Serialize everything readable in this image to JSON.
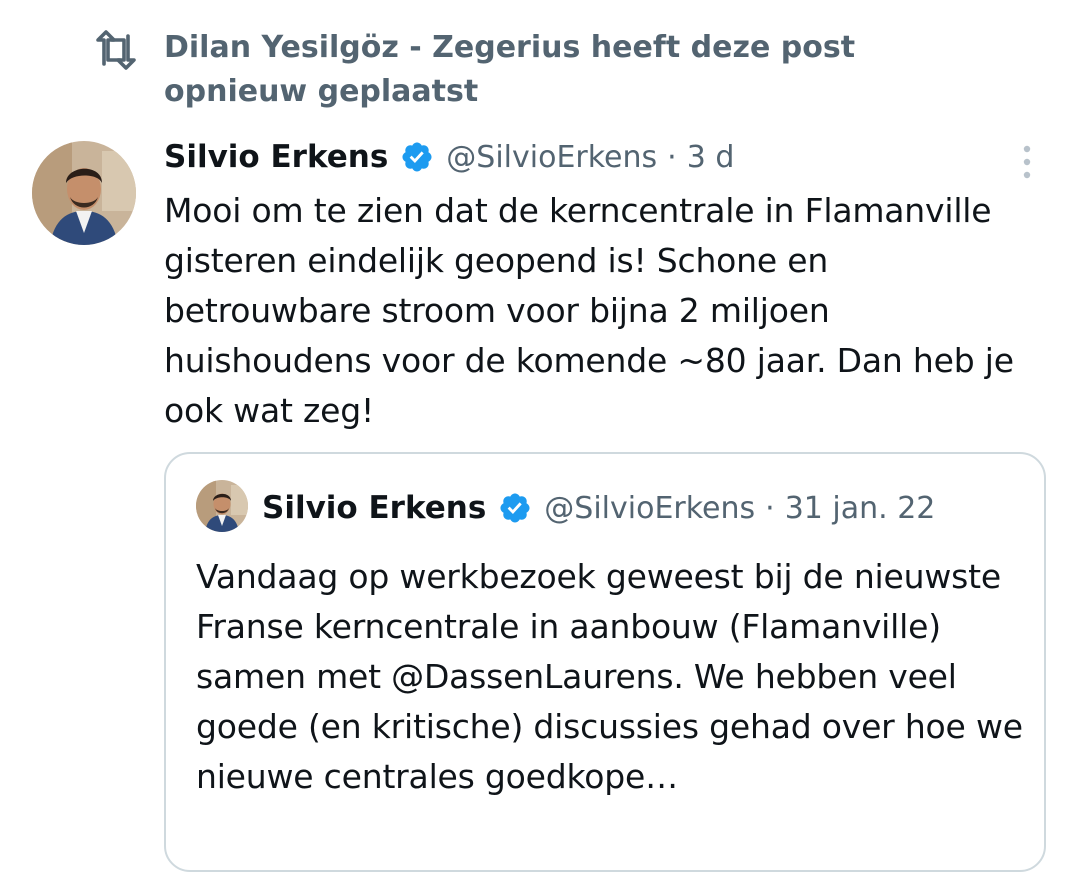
{
  "repost": {
    "icon": "repost-icon",
    "text": "Dilan Yesilgöz - Zegerius heeft deze post opnieuw geplaatst"
  },
  "tweet": {
    "name": "Silvio Erkens",
    "handle": "@SilvioErkens",
    "separator": "·",
    "time": "3 d",
    "text": "Mooi om te zien dat de kerncentrale in Flamanville gisteren eindelijk geopend is! Schone en betrouwbare stroom voor bijna 2 miljoen huishoudens voor de komende ~80 jaar. Dan heb je ook wat zeg!"
  },
  "quote": {
    "name": "Silvio Erkens",
    "handle": "@SilvioErkens",
    "separator": "·",
    "time": "31 jan. 22",
    "text": "Vandaag op werkbezoek geweest bij de nieuwste Franse kerncentrale in aanbouw (Flamanville) samen met @DassenLaurens. We hebben veel goede (en kritische) discussies gehad over hoe we nieuwe centrales goedkope…"
  },
  "colors": {
    "text": "#0f1419",
    "secondary": "#536471",
    "verified": "#1d9bf0",
    "border": "#cfd9de"
  }
}
